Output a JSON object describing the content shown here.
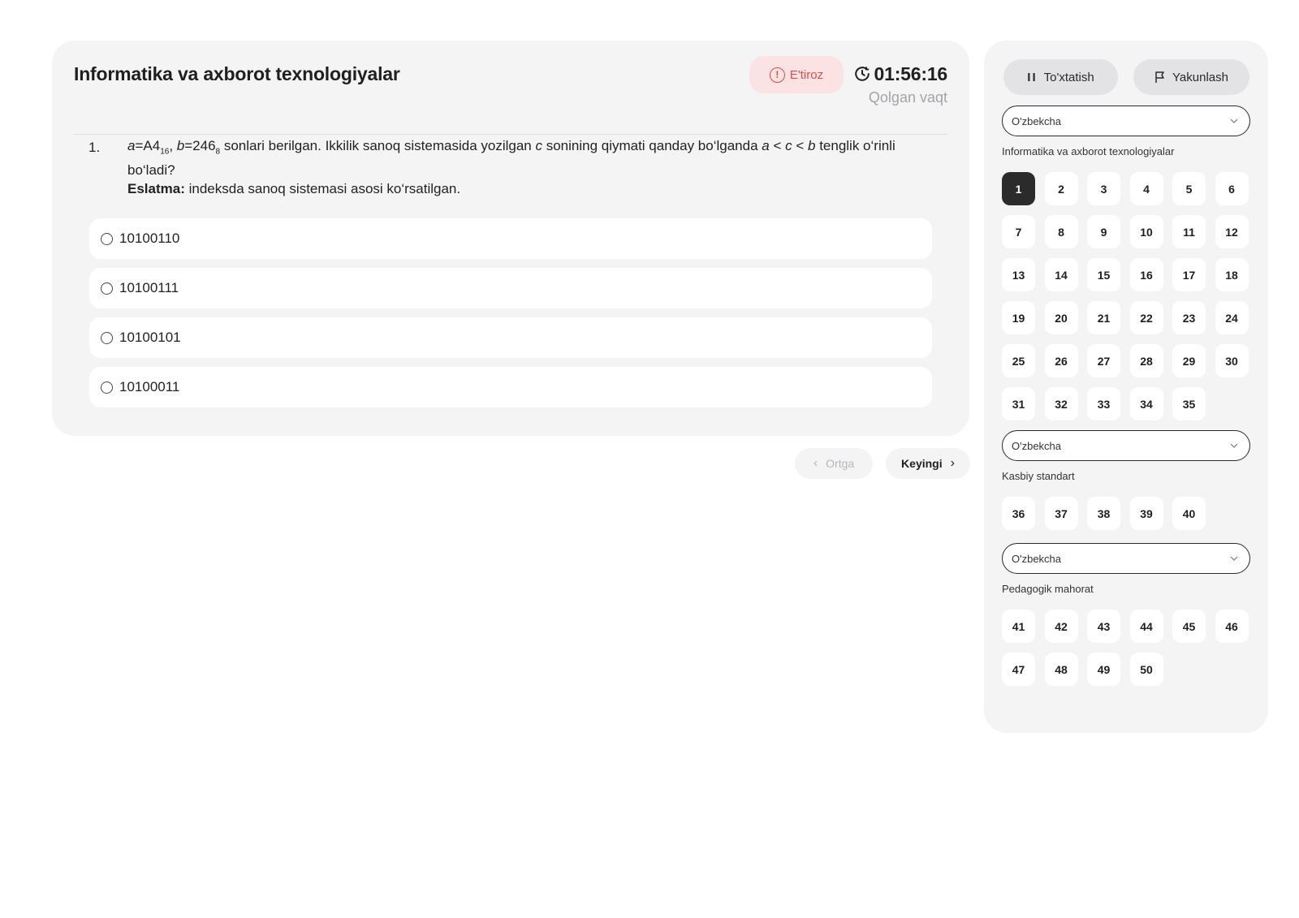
{
  "header": {
    "subject_title": "Informatika va axborot texnologiyalar",
    "objection_label": "E'tiroz",
    "timer_value": "01:56:16",
    "timer_label": "Qolgan vaqt"
  },
  "question": {
    "number": "1.",
    "text_parts": {
      "a": "a",
      "a_eq": "=A4",
      "a_sub": "16",
      "sep": ", ",
      "b": "b",
      "b_eq": "=246",
      "b_sub": "8",
      "mid": " sonlari berilgan. Ikkilik sanoq sistemasida yozilgan ",
      "c": "c",
      "mid2": " sonining qiymati qanday bo‘lganda ",
      "ineq_a": "a",
      "lt1": " < ",
      "ineq_c": "c",
      "lt2": " < ",
      "ineq_b": "b",
      "tail": " tenglik o‘rinli bo‘ladi?"
    },
    "note_label": "Eslatma:",
    "note_text": " indeksda sanoq sistemasi asosi ko‘rsatilgan.",
    "options": [
      "10100110",
      "10100111",
      "10100101",
      "10100011"
    ]
  },
  "navigation": {
    "prev_label": "Ortga",
    "next_label": "Keyingi"
  },
  "sidebar": {
    "pause_label": "To'xtatish",
    "finish_label": "Yakunlash",
    "sections": [
      {
        "language": "O'zbekcha",
        "title": "Informatika va axborot texnologiyalar",
        "questions": [
          "1",
          "2",
          "3",
          "4",
          "5",
          "6",
          "7",
          "8",
          "9",
          "10",
          "11",
          "12",
          "13",
          "14",
          "15",
          "16",
          "17",
          "18",
          "19",
          "20",
          "21",
          "22",
          "23",
          "24",
          "25",
          "26",
          "27",
          "28",
          "29",
          "30",
          "31",
          "32",
          "33",
          "34",
          "35"
        ]
      },
      {
        "language": "O'zbekcha",
        "title": "Kasbiy standart",
        "questions": [
          "36",
          "37",
          "38",
          "39",
          "40"
        ]
      },
      {
        "language": "O'zbekcha",
        "title": "Pedagogik mahorat",
        "questions": [
          "41",
          "42",
          "43",
          "44",
          "45",
          "46",
          "47",
          "48",
          "49",
          "50"
        ]
      }
    ],
    "active_question": "1"
  },
  "colors": {
    "card_bg": "#f4f4f5",
    "objection_bg": "#fbe3e3",
    "objection_fg": "#e04a4a",
    "active_bg": "#2b2b2b",
    "muted_text": "#a4a4a8"
  },
  "icons": {
    "objection": "info-circle-icon",
    "timer": "clock-icon",
    "pause": "pause-icon",
    "finish": "flag-icon",
    "select": "chevron-down-icon",
    "prev": "chevron-left-icon",
    "next": "chevron-right-icon"
  }
}
